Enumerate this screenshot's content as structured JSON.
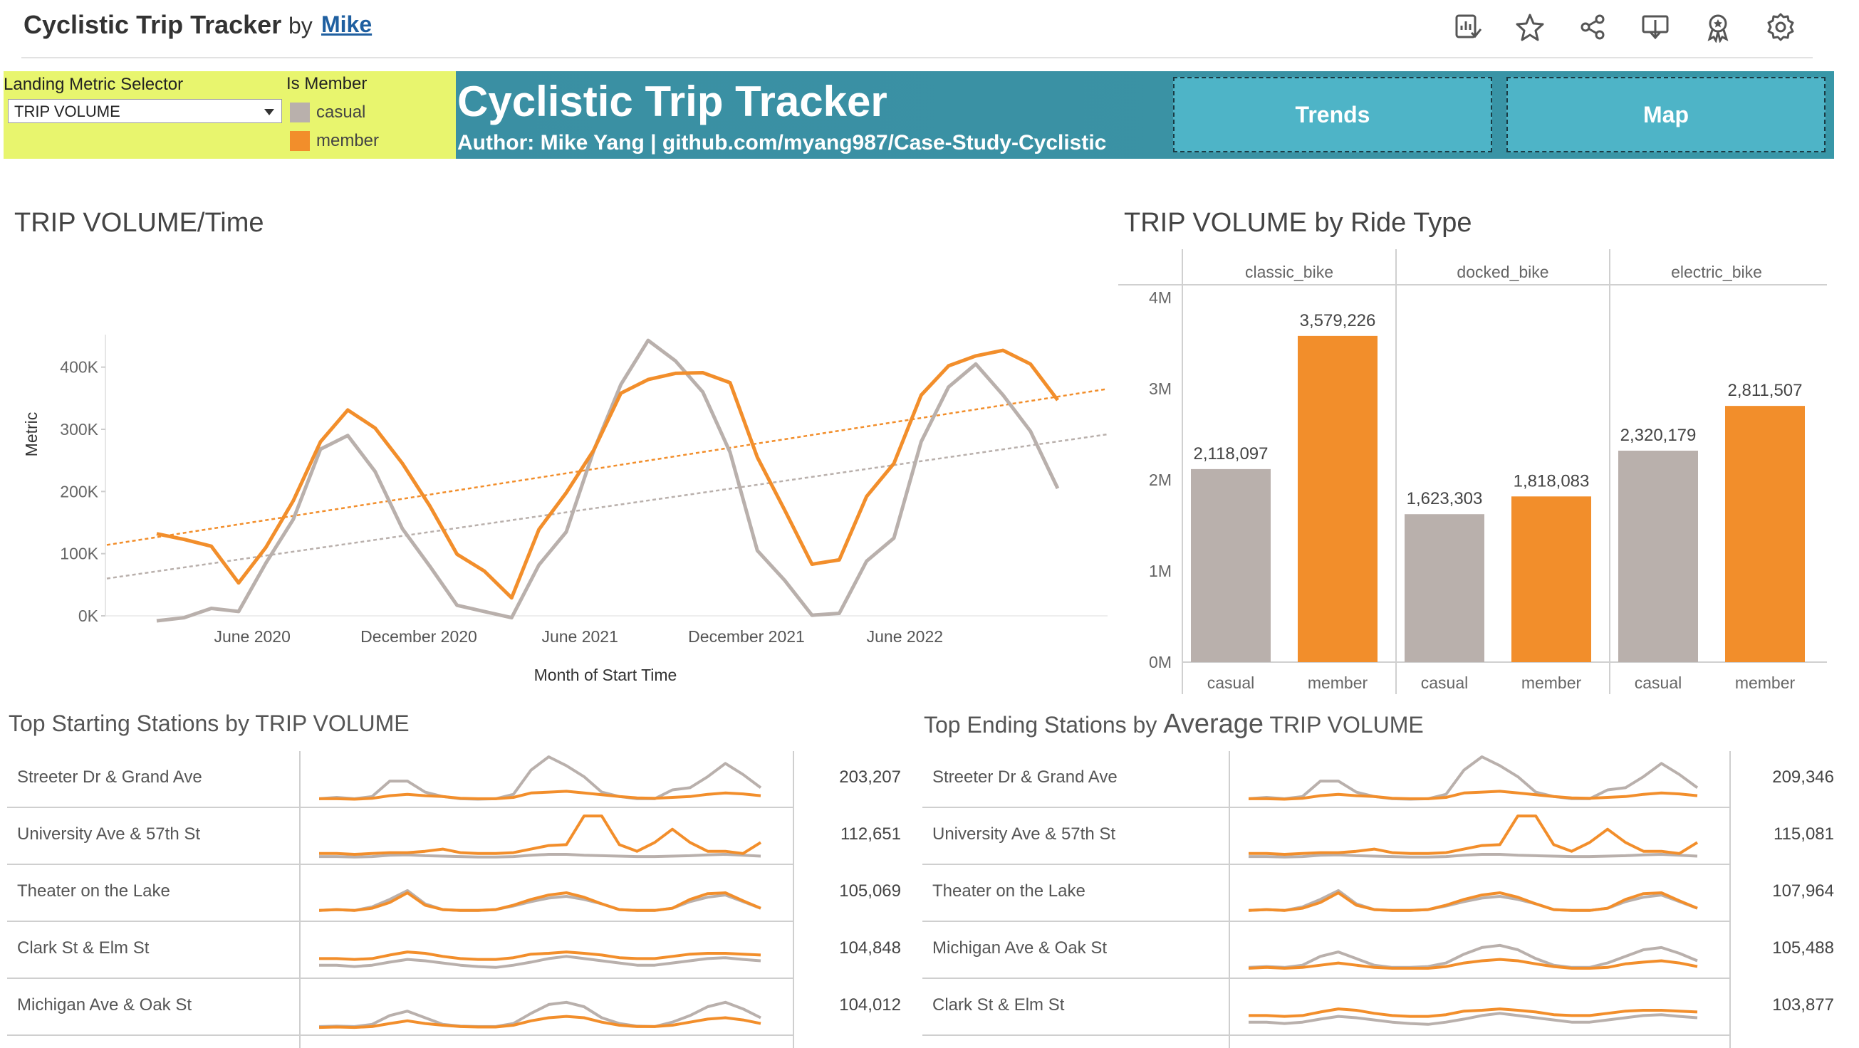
{
  "app": {
    "title": "Cyclistic Trip Tracker",
    "by": "by",
    "author": "Mike",
    "toolbar_icons": [
      "data-guide-icon",
      "favorite-star-icon",
      "share-icon",
      "download-icon",
      "badge-icon",
      "settings-gear-icon"
    ]
  },
  "filters": {
    "metric_label": "Landing Metric Selector",
    "metric_value": "TRIP VOLUME",
    "member_label": "Is Member",
    "legend": [
      {
        "label": "casual",
        "color": "#b9b0ac"
      },
      {
        "label": "member",
        "color": "#f28e2b"
      }
    ]
  },
  "banner": {
    "title": "Cyclistic Trip Tracker",
    "subtitle": "Author: Mike Yang | github.com/myang987/Case-Study-Cyclistic",
    "buttons": [
      "Trends",
      "Map"
    ]
  },
  "colors": {
    "casual": "#b9b0ac",
    "member": "#f28e2b",
    "banner": "#3a92a4",
    "button": "#4eb4c7",
    "filter_bg": "#e8f56e"
  },
  "chart_data": [
    {
      "type": "line",
      "title": "TRIP VOLUME/Time",
      "xlabel": "Month of Start Time",
      "ylabel": "Metric",
      "x_ticks": [
        "June 2020",
        "December 2020",
        "June 2021",
        "December 2021",
        "June 2022"
      ],
      "y_ticks": [
        "0K",
        "100K",
        "200K",
        "300K",
        "400K"
      ],
      "ylim": [
        0,
        450000
      ],
      "x": [
        "2020-03",
        "2020-04",
        "2020-05",
        "2020-06",
        "2020-07",
        "2020-08",
        "2020-09",
        "2020-10",
        "2020-11",
        "2020-12",
        "2021-01",
        "2021-02",
        "2021-03",
        "2021-04",
        "2021-05",
        "2021-06",
        "2021-07",
        "2021-08",
        "2021-09",
        "2021-10",
        "2021-11",
        "2021-12",
        "2022-01",
        "2022-02",
        "2022-03",
        "2022-04",
        "2022-05",
        "2022-06",
        "2022-07",
        "2022-08",
        "2022-09",
        "2022-10",
        "2022-11"
      ],
      "series": [
        {
          "name": "casual",
          "color": "#b9b0ac",
          "values": [
            -8000,
            -3000,
            12000,
            7000,
            85000,
            155000,
            268000,
            290000,
            232000,
            140000,
            80000,
            17000,
            7000,
            -3000,
            82000,
            135000,
            265000,
            372000,
            443000,
            410000,
            360000,
            263000,
            105000,
            57000,
            1000,
            4000,
            88000,
            125000,
            280000,
            368000,
            405000,
            355000,
            297000,
            205000
          ]
        },
        {
          "name": "member",
          "color": "#f28e2b",
          "values": [
            132000,
            123000,
            112000,
            53000,
            110000,
            185000,
            280000,
            331000,
            302000,
            245000,
            177000,
            99000,
            72000,
            29000,
            139000,
            198000,
            266000,
            358000,
            380000,
            390000,
            391000,
            375000,
            255000,
            170000,
            83000,
            90000,
            192000,
            245000,
            355000,
            402000,
            418000,
            427000,
            405000,
            347000
          ]
        }
      ],
      "trend_lines": [
        {
          "name": "casual",
          "color": "#b9b0ac",
          "start": 60000,
          "end": 292000
        },
        {
          "name": "member",
          "color": "#f28e2b",
          "start": 114000,
          "end": 365000
        }
      ]
    },
    {
      "type": "bar",
      "title": "TRIP VOLUME by Ride Type",
      "panels": [
        "classic_bike",
        "docked_bike",
        "electric_bike"
      ],
      "categories": [
        "casual",
        "member"
      ],
      "y_ticks": [
        "0M",
        "1M",
        "2M",
        "3M",
        "4M"
      ],
      "ylim": [
        0,
        4000000
      ],
      "series": [
        {
          "panel": "classic_bike",
          "values": [
            2118097,
            3579226
          ],
          "labels": [
            "2,118,097",
            "3,579,226"
          ]
        },
        {
          "panel": "docked_bike",
          "values": [
            1623303,
            1818083
          ],
          "labels": [
            "1,623,303",
            "1,818,083"
          ]
        },
        {
          "panel": "electric_bike",
          "values": [
            2320179,
            2811507
          ],
          "labels": [
            "2,320,179",
            "2,811,507"
          ]
        }
      ]
    }
  ],
  "start_stations": {
    "title_a": "Top Starting Stations by ",
    "title_b": "TRIP VOLUME",
    "rows": [
      {
        "name": "Streeter Dr & Grand Ave",
        "value": "203,207",
        "casual": [
          0.05,
          0.08,
          0.05,
          0.1,
          0.45,
          0.45,
          0.2,
          0.1,
          0.05,
          0.04,
          0.05,
          0.15,
          0.7,
          1.0,
          0.8,
          0.55,
          0.2,
          0.1,
          0.05,
          0.05,
          0.25,
          0.3,
          0.55,
          0.85,
          0.6,
          0.3
        ],
        "member": [
          0.05,
          0.05,
          0.04,
          0.06,
          0.12,
          0.15,
          0.12,
          0.1,
          0.06,
          0.05,
          0.05,
          0.08,
          0.18,
          0.2,
          0.22,
          0.18,
          0.14,
          0.1,
          0.07,
          0.06,
          0.08,
          0.1,
          0.15,
          0.18,
          0.16,
          0.12
        ]
      },
      {
        "name": "University Ave & 57th St",
        "value": "112,651",
        "casual": [
          0.03,
          0.03,
          0.02,
          0.03,
          0.06,
          0.07,
          0.05,
          0.04,
          0.03,
          0.02,
          0.02,
          0.03,
          0.06,
          0.08,
          0.08,
          0.06,
          0.05,
          0.04,
          0.03,
          0.03,
          0.04,
          0.05,
          0.07,
          0.08,
          0.06,
          0.04
        ],
        "member": [
          0.1,
          0.1,
          0.08,
          0.1,
          0.12,
          0.12,
          0.15,
          0.2,
          0.12,
          0.1,
          0.1,
          0.12,
          0.2,
          0.28,
          0.3,
          0.95,
          0.95,
          0.3,
          0.15,
          0.35,
          0.65,
          0.35,
          0.15,
          0.15,
          0.1,
          0.35
        ]
      },
      {
        "name": "Theater on the Lake",
        "value": "105,069",
        "casual": [
          0.1,
          0.12,
          0.1,
          0.18,
          0.35,
          0.55,
          0.25,
          0.12,
          0.1,
          0.1,
          0.12,
          0.2,
          0.3,
          0.38,
          0.42,
          0.35,
          0.25,
          0.12,
          0.1,
          0.1,
          0.15,
          0.3,
          0.4,
          0.45,
          0.3,
          0.15
        ],
        "member": [
          0.1,
          0.12,
          0.1,
          0.15,
          0.28,
          0.5,
          0.22,
          0.12,
          0.1,
          0.1,
          0.12,
          0.22,
          0.35,
          0.45,
          0.5,
          0.4,
          0.25,
          0.12,
          0.1,
          0.1,
          0.15,
          0.35,
          0.48,
          0.5,
          0.32,
          0.15
        ]
      },
      {
        "name": "Clark St & Elm St",
        "value": "104,848",
        "casual": [
          0.15,
          0.15,
          0.12,
          0.15,
          0.22,
          0.28,
          0.25,
          0.2,
          0.15,
          0.12,
          0.1,
          0.15,
          0.22,
          0.3,
          0.35,
          0.3,
          0.25,
          0.2,
          0.15,
          0.15,
          0.2,
          0.25,
          0.3,
          0.32,
          0.28,
          0.25
        ],
        "member": [
          0.3,
          0.3,
          0.28,
          0.3,
          0.38,
          0.45,
          0.42,
          0.35,
          0.3,
          0.28,
          0.28,
          0.32,
          0.4,
          0.42,
          0.45,
          0.42,
          0.38,
          0.32,
          0.3,
          0.3,
          0.35,
          0.4,
          0.42,
          0.42,
          0.4,
          0.38
        ]
      },
      {
        "name": "Michigan Ave & Oak St",
        "value": "104,012",
        "casual": [
          0.05,
          0.06,
          0.05,
          0.1,
          0.3,
          0.4,
          0.25,
          0.1,
          0.06,
          0.05,
          0.05,
          0.12,
          0.35,
          0.55,
          0.6,
          0.5,
          0.25,
          0.12,
          0.06,
          0.05,
          0.15,
          0.3,
          0.5,
          0.6,
          0.45,
          0.25
        ],
        "member": [
          0.03,
          0.04,
          0.03,
          0.05,
          0.12,
          0.18,
          0.12,
          0.08,
          0.05,
          0.04,
          0.04,
          0.08,
          0.18,
          0.25,
          0.28,
          0.25,
          0.15,
          0.08,
          0.05,
          0.05,
          0.08,
          0.15,
          0.22,
          0.25,
          0.2,
          0.12
        ]
      }
    ]
  },
  "end_stations": {
    "title_a": "Top Ending Stations by ",
    "title_b": "Average",
    "title_c": " TRIP VOLUME",
    "rows": [
      {
        "name": "Streeter Dr & Grand Ave",
        "value": "209,346",
        "casual": [
          0.05,
          0.08,
          0.05,
          0.1,
          0.45,
          0.45,
          0.2,
          0.1,
          0.05,
          0.04,
          0.05,
          0.15,
          0.7,
          1.0,
          0.8,
          0.55,
          0.2,
          0.1,
          0.05,
          0.05,
          0.25,
          0.3,
          0.55,
          0.85,
          0.6,
          0.3
        ],
        "member": [
          0.05,
          0.05,
          0.04,
          0.06,
          0.12,
          0.15,
          0.12,
          0.1,
          0.06,
          0.05,
          0.05,
          0.08,
          0.18,
          0.2,
          0.22,
          0.18,
          0.14,
          0.1,
          0.07,
          0.06,
          0.08,
          0.1,
          0.15,
          0.18,
          0.16,
          0.12
        ]
      },
      {
        "name": "University Ave & 57th St",
        "value": "115,081",
        "casual": [
          0.03,
          0.03,
          0.02,
          0.03,
          0.06,
          0.07,
          0.05,
          0.04,
          0.03,
          0.02,
          0.02,
          0.03,
          0.06,
          0.08,
          0.08,
          0.06,
          0.05,
          0.04,
          0.03,
          0.03,
          0.04,
          0.05,
          0.07,
          0.08,
          0.06,
          0.04
        ],
        "member": [
          0.1,
          0.1,
          0.08,
          0.1,
          0.12,
          0.12,
          0.15,
          0.2,
          0.12,
          0.1,
          0.1,
          0.12,
          0.2,
          0.28,
          0.3,
          0.95,
          0.95,
          0.3,
          0.15,
          0.35,
          0.65,
          0.35,
          0.15,
          0.15,
          0.1,
          0.35
        ]
      },
      {
        "name": "Theater on the Lake",
        "value": "107,964",
        "casual": [
          0.1,
          0.12,
          0.1,
          0.18,
          0.35,
          0.55,
          0.25,
          0.12,
          0.1,
          0.1,
          0.12,
          0.2,
          0.3,
          0.38,
          0.42,
          0.35,
          0.25,
          0.12,
          0.1,
          0.1,
          0.15,
          0.3,
          0.4,
          0.45,
          0.3,
          0.15
        ],
        "member": [
          0.1,
          0.12,
          0.1,
          0.15,
          0.28,
          0.5,
          0.22,
          0.12,
          0.1,
          0.1,
          0.12,
          0.22,
          0.35,
          0.45,
          0.5,
          0.4,
          0.25,
          0.12,
          0.1,
          0.1,
          0.15,
          0.35,
          0.48,
          0.5,
          0.32,
          0.15
        ]
      },
      {
        "name": "Michigan Ave & Oak St",
        "value": "105,488",
        "casual": [
          0.1,
          0.12,
          0.1,
          0.15,
          0.35,
          0.45,
          0.3,
          0.15,
          0.1,
          0.1,
          0.12,
          0.2,
          0.4,
          0.55,
          0.6,
          0.5,
          0.3,
          0.15,
          0.1,
          0.1,
          0.2,
          0.35,
          0.5,
          0.55,
          0.42,
          0.25
        ],
        "member": [
          0.08,
          0.1,
          0.08,
          0.1,
          0.15,
          0.2,
          0.15,
          0.1,
          0.08,
          0.08,
          0.08,
          0.12,
          0.2,
          0.25,
          0.28,
          0.25,
          0.18,
          0.12,
          0.08,
          0.08,
          0.1,
          0.18,
          0.22,
          0.25,
          0.2,
          0.12
        ]
      },
      {
        "name": "Clark St & Elm St",
        "value": "103,877",
        "casual": [
          0.15,
          0.15,
          0.12,
          0.15,
          0.22,
          0.28,
          0.25,
          0.2,
          0.15,
          0.12,
          0.1,
          0.15,
          0.22,
          0.3,
          0.35,
          0.3,
          0.25,
          0.2,
          0.15,
          0.15,
          0.2,
          0.25,
          0.3,
          0.32,
          0.28,
          0.25
        ],
        "member": [
          0.3,
          0.3,
          0.28,
          0.3,
          0.38,
          0.45,
          0.42,
          0.35,
          0.3,
          0.28,
          0.28,
          0.32,
          0.4,
          0.42,
          0.45,
          0.42,
          0.38,
          0.32,
          0.3,
          0.3,
          0.35,
          0.4,
          0.42,
          0.42,
          0.4,
          0.38
        ]
      }
    ]
  }
}
